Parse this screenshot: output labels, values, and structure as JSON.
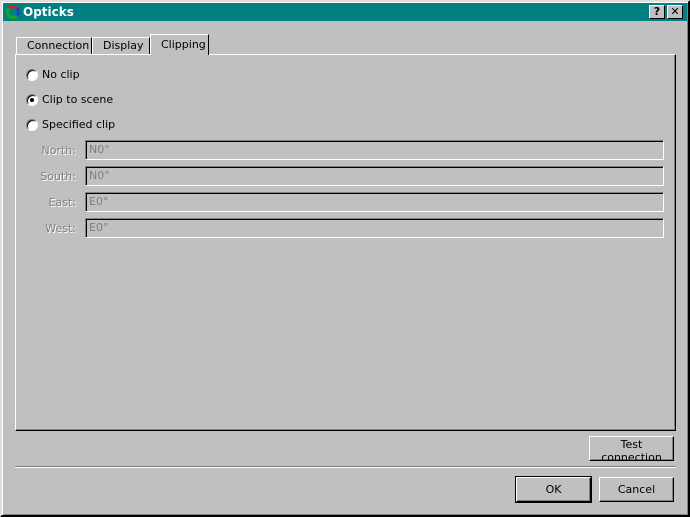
{
  "window": {
    "title": "Opticks",
    "help_label": "?",
    "close_label": "✕",
    "icon": "app-icon"
  },
  "tabs": [
    {
      "label": "Connection"
    },
    {
      "label": "Display"
    },
    {
      "label": "Clipping",
      "selected": true
    }
  ],
  "clipping": {
    "options": [
      {
        "label": "No clip",
        "checked": false
      },
      {
        "label": "Clip to scene",
        "checked": true
      },
      {
        "label": "Specified clip",
        "checked": false
      }
    ],
    "fields": [
      {
        "label": "North:",
        "value": "N0°"
      },
      {
        "label": "South:",
        "value": "N0°"
      },
      {
        "label": "East:",
        "value": "E0°"
      },
      {
        "label": "West:",
        "value": "E0°"
      }
    ]
  },
  "buttons": {
    "test": "Test connection",
    "ok": "OK",
    "cancel": "Cancel"
  }
}
